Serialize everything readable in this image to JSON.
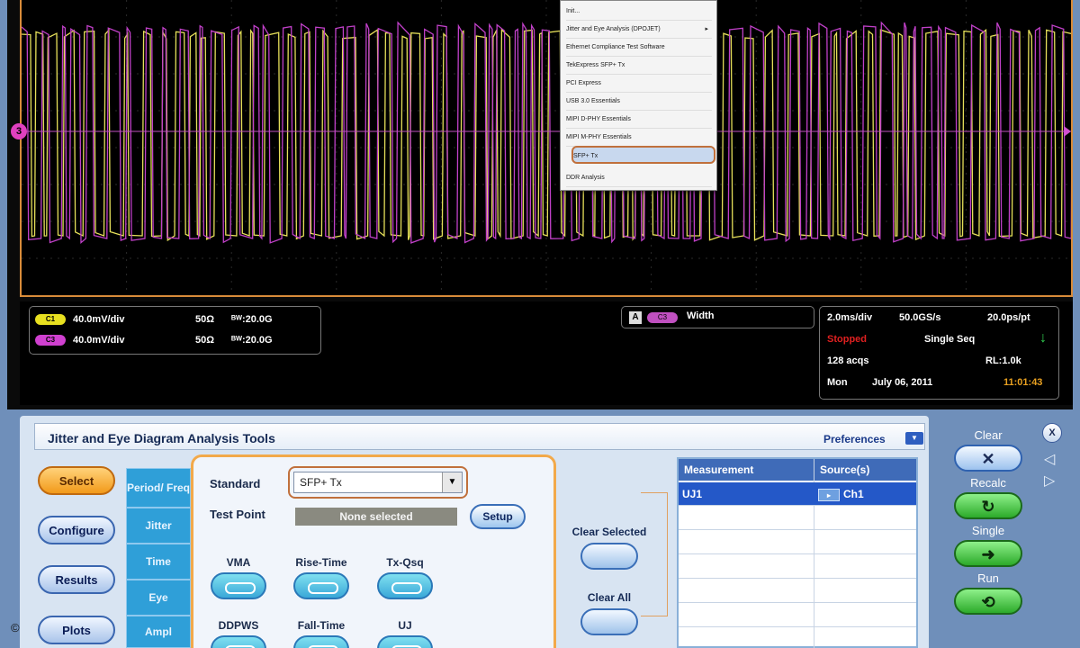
{
  "context_menu": {
    "items": [
      {
        "label": "Init..."
      },
      {
        "label": "Jitter and Eye Analysis (DPOJET)",
        "has_submenu": true
      },
      {
        "label": "Ethernet Compliance Test Software"
      },
      {
        "label": "TekExpress SFP+ Tx"
      },
      {
        "label": "PCI Express"
      },
      {
        "label": "USB 3.0 Essentials"
      },
      {
        "label": "MIPI D-PHY Essentials"
      },
      {
        "label": "MIPI M-PHY Essentials"
      },
      {
        "label": "SFP+ Tx",
        "selected": true
      },
      {
        "label": "DDR Analysis"
      }
    ]
  },
  "channel_marker": "3",
  "channels": [
    {
      "tag": "C1",
      "volts": "40.0mV/div",
      "impedance": "50Ω",
      "bw": "ᴮᵂ:20.0G",
      "color": "#e8e020"
    },
    {
      "tag": "C3",
      "volts": "40.0mV/div",
      "impedance": "50Ω",
      "bw": "ᴮᵂ:20.0G",
      "color": "#d040d0"
    }
  ],
  "measurement_readout": {
    "a_label": "A",
    "ch_tag": "C3",
    "label": "Width"
  },
  "acquisition": {
    "timebase": "2.0ms/div",
    "sample_rate": "50.0GS/s",
    "resolution": "20.0ps/pt",
    "status": "Stopped",
    "mode": "Single Seq",
    "acqs": "128 acqs",
    "record_length": "RL:1.0k",
    "day": "Mon",
    "date": "July 06, 2011",
    "time": "11:01:43"
  },
  "panel": {
    "title": "Jitter and Eye Diagram Analysis Tools",
    "preferences": "Preferences"
  },
  "side_buttons": [
    "Select",
    "Configure",
    "Results",
    "Plots"
  ],
  "tabs": [
    "Period/ Freq",
    "Jitter",
    "Time",
    "Eye",
    "Ampl"
  ],
  "config": {
    "standard_label": "Standard",
    "standard_value": "SFP+ Tx",
    "test_point_label": "Test Point",
    "test_point_value": "None selected",
    "setup_label": "Setup",
    "measurements": [
      "VMA",
      "Rise-Time",
      "Tx-Qsq",
      "DDPWS",
      "Fall-Time",
      "UJ"
    ]
  },
  "clear_selected": "Clear Selected",
  "clear_all": "Clear All",
  "table": {
    "headers": [
      "Measurement",
      "Source(s)"
    ],
    "rows": [
      {
        "measurement": "UJ1",
        "source": "Ch1"
      }
    ]
  },
  "controls": {
    "clear": "Clear",
    "recalc": "Recalc",
    "single": "Single",
    "run": "Run",
    "close": "X"
  },
  "copyright": "©"
}
